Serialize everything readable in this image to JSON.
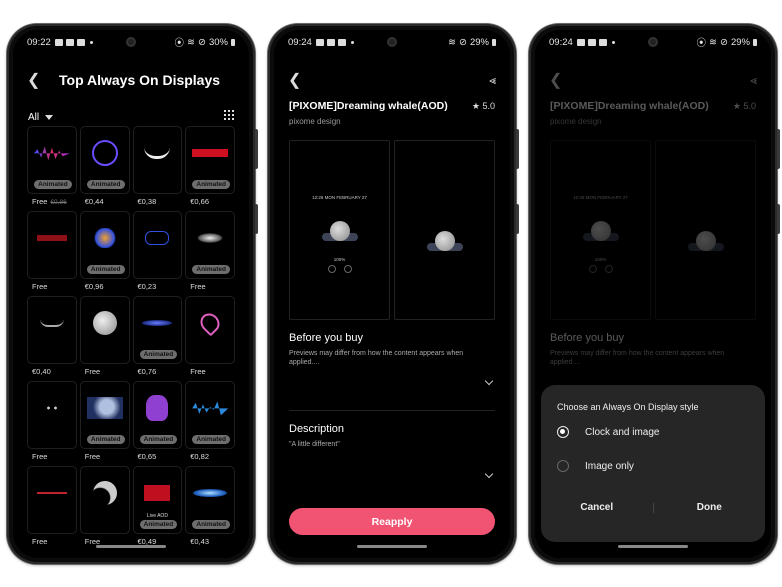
{
  "phone1": {
    "status": {
      "time": "09:22",
      "battery": "30%"
    },
    "title": "Top Always On Displays",
    "filter": "All",
    "items": [
      {
        "name": "sound-wave",
        "price": "Free",
        "old_price": "€0,86",
        "animated": true
      },
      {
        "name": "galaxy-ring",
        "price": "€0,44",
        "animated": true
      },
      {
        "name": "smile-face",
        "price": "€0,38",
        "animated": false
      },
      {
        "name": "dont-touch-red",
        "price": "€0,66",
        "animated": true
      },
      {
        "name": "dont-touch-dark",
        "price": "Free",
        "animated": false
      },
      {
        "name": "color-splash",
        "price": "€0,96",
        "animated": true
      },
      {
        "name": "gamepad",
        "price": "€0,23",
        "animated": false
      },
      {
        "name": "galaxy",
        "price": "Free",
        "animated": true
      },
      {
        "name": "cat-smile",
        "price": "€0,40",
        "animated": false
      },
      {
        "name": "moon",
        "price": "Free",
        "animated": false
      },
      {
        "name": "blue-horizon",
        "price": "€0,76",
        "animated": true
      },
      {
        "name": "neon-hearts",
        "price": "Free",
        "animated": false
      },
      {
        "name": "black-cat",
        "price": "Free",
        "animated": false
      },
      {
        "name": "moon-night",
        "price": "Free",
        "animated": true
      },
      {
        "name": "purple-owl",
        "price": "€0,65",
        "animated": true
      },
      {
        "name": "blue-wave",
        "price": "€0,82",
        "animated": true
      },
      {
        "name": "heartbeat",
        "price": "Free",
        "animated": false
      },
      {
        "name": "half-moon",
        "price": "Free",
        "animated": false
      },
      {
        "name": "turkish-flag",
        "price": "€0,49",
        "animated": true,
        "caption": "Live AOD"
      },
      {
        "name": "blue-energy",
        "price": "€0,43",
        "animated": true
      }
    ],
    "badge_label": "Animated"
  },
  "detail": {
    "title": "[PIXOME]Dreaming whale(AOD)",
    "rating": "5.0",
    "developer": "pixome design",
    "preview_clock": "12:26  MON FEBRUARY 27",
    "preview_battery": "100%",
    "before_buy_title": "Before you buy",
    "before_buy_text": "Previews may differ from how the content appears when applied....",
    "description_title": "Description",
    "description_text": "\"A little different\"",
    "reapply_label": "Reapply"
  },
  "phone2": {
    "status": {
      "time": "09:24",
      "battery": "29%"
    }
  },
  "phone3": {
    "status": {
      "time": "09:24",
      "battery": "29%"
    },
    "dialog": {
      "title": "Choose an Always On Display style",
      "options": [
        {
          "label": "Clock and image",
          "selected": true
        },
        {
          "label": "Image only",
          "selected": false
        }
      ],
      "cancel_label": "Cancel",
      "done_label": "Done"
    }
  },
  "colors": {
    "accent": "#f05472",
    "sheet": "#262626",
    "badge": "#6e6e6e"
  }
}
